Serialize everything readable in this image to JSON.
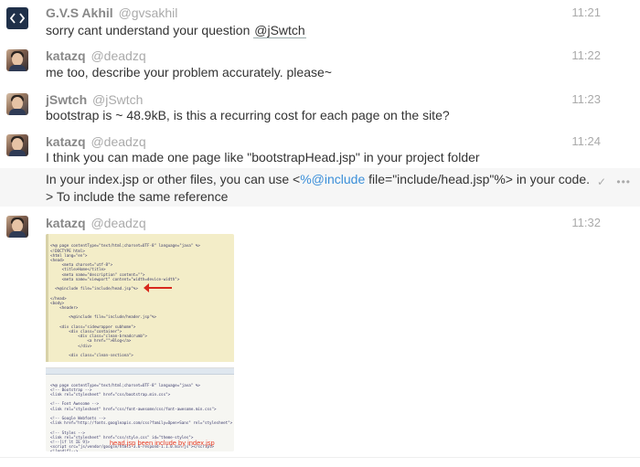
{
  "messages": [
    {
      "display_name": "G.V.S Akhil",
      "username": "@gvsakhil",
      "time": "11:21",
      "text_before": "sorry cant understand your question ",
      "mention": "@jSwtch",
      "avatar_icon": "code-brackets-icon"
    },
    {
      "display_name": "katazq",
      "username": "@deadzq",
      "time": "11:22",
      "text": "me too, describe your problem accurately. please~"
    },
    {
      "display_name": "jSwtch",
      "username": "@jSwtch",
      "time": "11:23",
      "text": "bootstrap is ~ 48.9kB, is this a recurring cost for each page on the site?"
    },
    {
      "display_name": "katazq",
      "username": "@deadzq",
      "time": "11:24",
      "text": "I think you can made one page like \"bootstrapHead.jsp\" in your project folder"
    },
    {
      "text_before": "In your index.jsp or other files, you can use <",
      "link": "%@include",
      "text_after": " file=\"include/head.jsp\"%> in your code. > To include the same reference",
      "actions": [
        "checkmark-icon",
        "more-icon"
      ]
    },
    {
      "display_name": "katazq",
      "username": "@deadzq",
      "time": "11:32",
      "image_caption": "head.jsp been include by index.jsp"
    }
  ]
}
